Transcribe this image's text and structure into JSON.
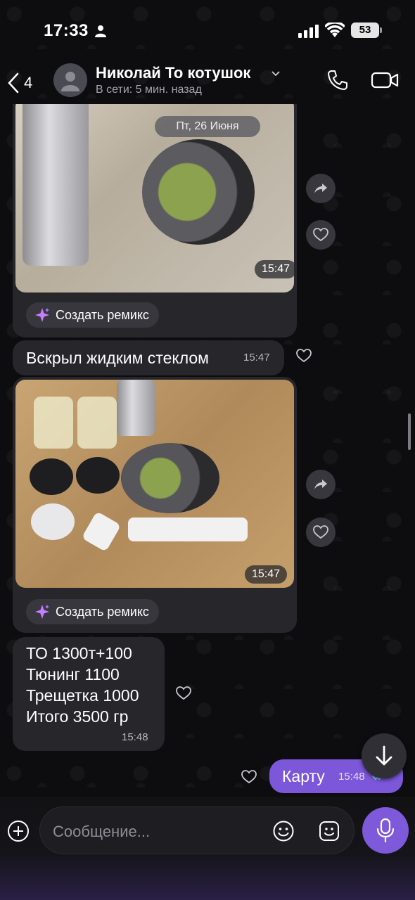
{
  "status_bar": {
    "time": "17:33",
    "battery": "53"
  },
  "header": {
    "back_count": "4",
    "contact_name": "Николай То котушок",
    "presence": "В сети: 5 мин. назад"
  },
  "chat": {
    "date_separator": "Пт, 26 Июня",
    "messages": [
      {
        "type": "photo",
        "time": "15:47",
        "remix_label": "Создать ремикс"
      },
      {
        "type": "text",
        "text": "Вскрыл жидким стеклом",
        "time": "15:47"
      },
      {
        "type": "photo",
        "time": "15:47",
        "remix_label": "Создать ремикс"
      },
      {
        "type": "text",
        "text": "ТО 1300т+100\nТюнинг 1100\nТрещетка 1000\nИтого 3500 гр",
        "time": "15:48"
      },
      {
        "type": "outgoing",
        "text": "Карту",
        "time": "15:48"
      }
    ]
  },
  "input": {
    "placeholder": "Сообщение..."
  },
  "colors": {
    "accent": "#7c57d9",
    "incoming_bubble": "#26262b",
    "background": "#0d0d10"
  }
}
